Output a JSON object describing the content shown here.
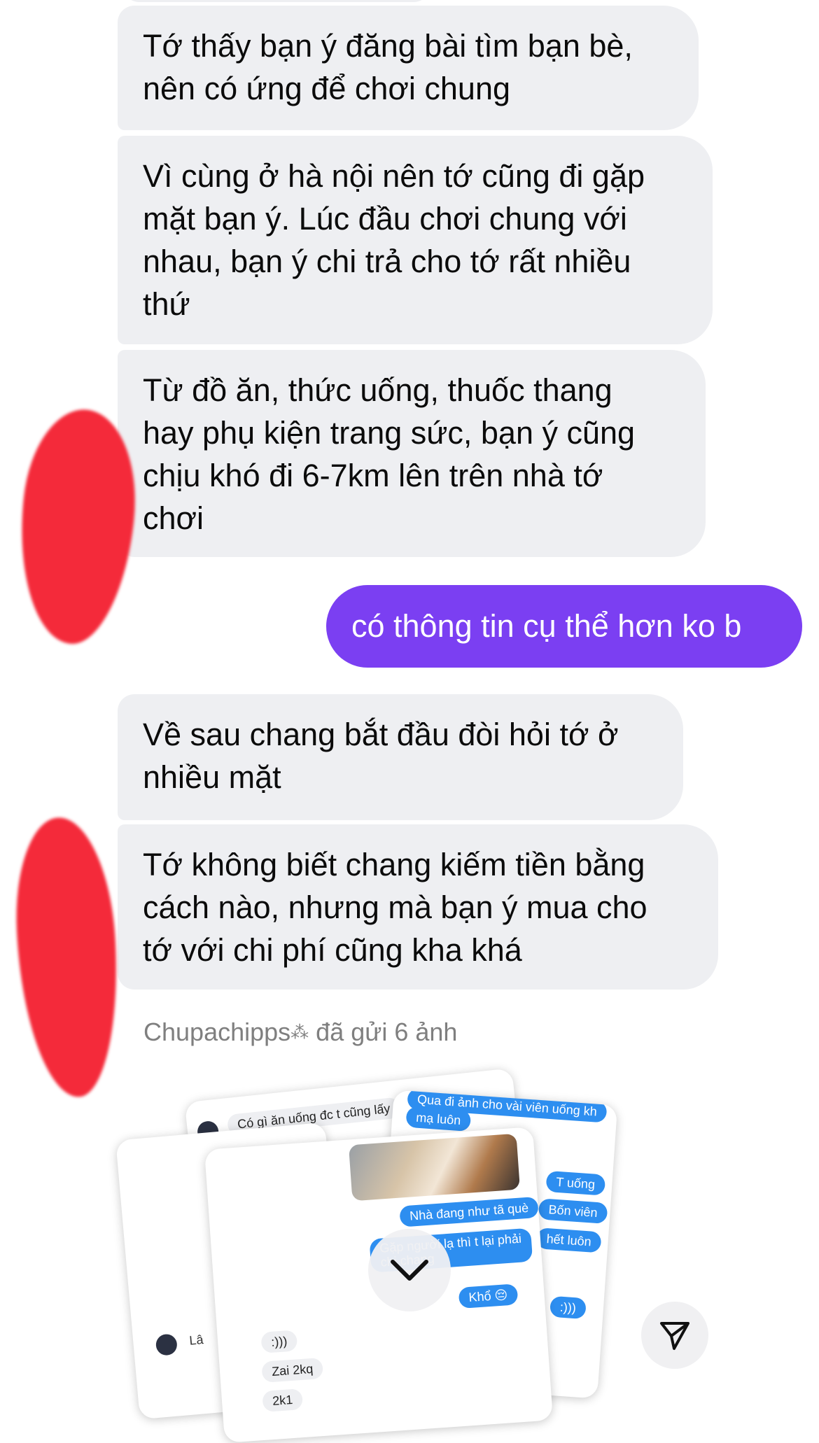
{
  "messages": [
    {
      "from": "them",
      "text": "Tớ thấy bạn ý đăng bài tìm bạn bè,\nnên có ứng để chơi chung"
    },
    {
      "from": "them",
      "text": "Vì cùng ở hà nội nên tớ cũng đi gặp\nmặt bạn ý. Lúc đầu chơi chung với\nnhau, bạn ý chi trả cho tớ rất nhiều\nthứ"
    },
    {
      "from": "them",
      "text": "Từ đồ ăn, thức uống, thuốc thang\nhay phụ kiện trang sức, bạn ý cũng\nchịu khó đi 6-7km lên trên nhà tớ\nchơi"
    },
    {
      "from": "me",
      "text": "có thông tin cụ thể hơn ko b"
    },
    {
      "from": "them",
      "text": "Về sau chang bắt đầu đòi hỏi tớ ở\nnhiều mặt"
    },
    {
      "from": "them",
      "text": "Tớ không biết chang kiếm tiền bằng\ncách nào, nhưng mà bạn ý mua cho\ntớ với chi phí cũng kha khá"
    }
  ],
  "status": {
    "sender": "Chupachipps",
    "sender_icon": "sparkle",
    "action": "đã gửi 6 ảnh"
  },
  "photo_stack": {
    "back_card": {
      "top_message": "Có gì ăn uống đc t cũng lấy"
    },
    "right_card": {
      "messages": [
        "Qua đi ảnh cho vài viên uống kh",
        "mạ luôn",
        "T uống",
        "Bốn viên",
        "hết luôn",
        ":)))"
      ]
    },
    "front_card": {
      "messages": [
        "Nhà đang như tã què",
        "Gặp người lạ thì t lại phải\nchi chang",
        "Khổ 😔",
        ":)))",
        "Zai 2kq",
        "2k1"
      ]
    },
    "left_card": {
      "label": "Lâ"
    }
  },
  "controls": {
    "scroll_down_icon": "chevron-down",
    "send_icon": "paper-plane"
  },
  "colors": {
    "sent_bubble": "#7b3ff2",
    "received_bubble": "#eeeff2",
    "redaction": "#f42a3a",
    "mini_blue": "#2d8ef0"
  }
}
